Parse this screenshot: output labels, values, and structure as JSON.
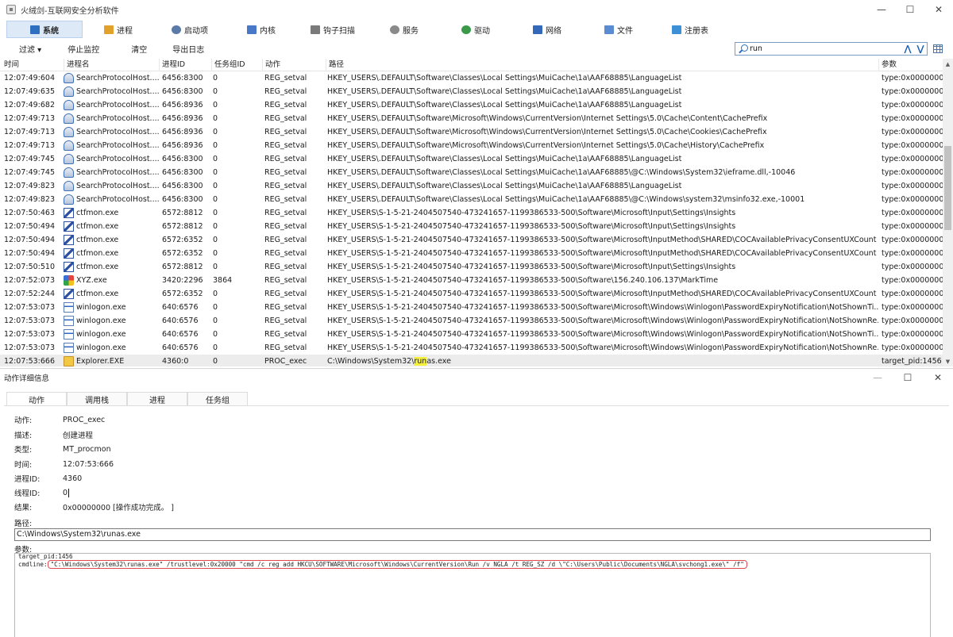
{
  "app": {
    "title": "火绒剑-互联网安全分析软件",
    "window_controls": {
      "minimize": "—",
      "maximize": "☐",
      "close": "✕"
    }
  },
  "main_tabs": [
    {
      "label": "系统",
      "icon": "system-icon",
      "color": "#2f6fbf",
      "active": true
    },
    {
      "label": "进程",
      "icon": "process-icon",
      "color": "#e2a12a",
      "active": false
    },
    {
      "label": "启动项",
      "icon": "startup-icon",
      "color": "#5a7aa8",
      "active": false
    },
    {
      "label": "内核",
      "icon": "kernel-icon",
      "color": "#4a78c8",
      "active": false
    },
    {
      "label": "钩子扫描",
      "icon": "hook-icon",
      "color": "#7a7a7a",
      "active": false
    },
    {
      "label": "服务",
      "icon": "service-icon",
      "color": "#8a8a8a",
      "active": false
    },
    {
      "label": "驱动",
      "icon": "driver-icon",
      "color": "#3a9a4a",
      "active": false
    },
    {
      "label": "网络",
      "icon": "network-icon",
      "color": "#3468b8",
      "active": false
    },
    {
      "label": "文件",
      "icon": "file-icon",
      "color": "#5b8bd0",
      "active": false
    },
    {
      "label": "注册表",
      "icon": "registry-icon",
      "color": "#3d8fd6",
      "active": false
    }
  ],
  "toolbar": {
    "filter_label": "过滤 ▾",
    "stop_label": "停止监控",
    "clear_label": "清空",
    "export_label": "导出日志",
    "search_value": "run",
    "nav_up": "⋀",
    "nav_down": "⋁"
  },
  "table": {
    "columns": [
      "时间",
      "进程名",
      "进程ID",
      "任务组ID",
      "动作",
      "路径",
      "参数"
    ],
    "rows": [
      {
        "time": "12:07:49:604",
        "icon": "search-host-icon",
        "proc": "SearchProtocolHost....",
        "pid": "6456:8300",
        "task": "0",
        "action": "REG_setval",
        "path": "HKEY_USERS\\.DEFAULT\\Software\\Classes\\Local Settings\\MuiCache\\1a\\AAF68885\\LanguageList",
        "param": "type:0x00000007"
      },
      {
        "time": "12:07:49:635",
        "icon": "search-host-icon",
        "proc": "SearchProtocolHost....",
        "pid": "6456:8300",
        "task": "0",
        "action": "REG_setval",
        "path": "HKEY_USERS\\.DEFAULT\\Software\\Classes\\Local Settings\\MuiCache\\1a\\AAF68885\\LanguageList",
        "param": "type:0x00000007"
      },
      {
        "time": "12:07:49:682",
        "icon": "search-host-icon",
        "proc": "SearchProtocolHost....",
        "pid": "6456:8936",
        "task": "0",
        "action": "REG_setval",
        "path": "HKEY_USERS\\.DEFAULT\\Software\\Classes\\Local Settings\\MuiCache\\1a\\AAF68885\\LanguageList",
        "param": "type:0x00000007"
      },
      {
        "time": "12:07:49:713",
        "icon": "search-host-icon",
        "proc": "SearchProtocolHost....",
        "pid": "6456:8936",
        "task": "0",
        "action": "REG_setval",
        "path": "HKEY_USERS\\.DEFAULT\\Software\\Microsoft\\Windows\\CurrentVersion\\Internet Settings\\5.0\\Cache\\Content\\CachePrefix",
        "param": "type:0x00000001"
      },
      {
        "time": "12:07:49:713",
        "icon": "search-host-icon",
        "proc": "SearchProtocolHost....",
        "pid": "6456:8936",
        "task": "0",
        "action": "REG_setval",
        "path": "HKEY_USERS\\.DEFAULT\\Software\\Microsoft\\Windows\\CurrentVersion\\Internet Settings\\5.0\\Cache\\Cookies\\CachePrefix",
        "param": "type:0x00000001"
      },
      {
        "time": "12:07:49:713",
        "icon": "search-host-icon",
        "proc": "SearchProtocolHost....",
        "pid": "6456:8936",
        "task": "0",
        "action": "REG_setval",
        "path": "HKEY_USERS\\.DEFAULT\\Software\\Microsoft\\Windows\\CurrentVersion\\Internet Settings\\5.0\\Cache\\History\\CachePrefix",
        "param": "type:0x00000001"
      },
      {
        "time": "12:07:49:745",
        "icon": "search-host-icon",
        "proc": "SearchProtocolHost....",
        "pid": "6456:8300",
        "task": "0",
        "action": "REG_setval",
        "path": "HKEY_USERS\\.DEFAULT\\Software\\Classes\\Local Settings\\MuiCache\\1a\\AAF68885\\LanguageList",
        "param": "type:0x00000007"
      },
      {
        "time": "12:07:49:745",
        "icon": "search-host-icon",
        "proc": "SearchProtocolHost....",
        "pid": "6456:8300",
        "task": "0",
        "action": "REG_setval",
        "path": "HKEY_USERS\\.DEFAULT\\Software\\Classes\\Local Settings\\MuiCache\\1a\\AAF68885\\@C:\\Windows\\System32\\ieframe.dll,-10046",
        "param": "type:0x00000001"
      },
      {
        "time": "12:07:49:823",
        "icon": "search-host-icon",
        "proc": "SearchProtocolHost....",
        "pid": "6456:8300",
        "task": "0",
        "action": "REG_setval",
        "path": "HKEY_USERS\\.DEFAULT\\Software\\Classes\\Local Settings\\MuiCache\\1a\\AAF68885\\LanguageList",
        "param": "type:0x00000007"
      },
      {
        "time": "12:07:49:823",
        "icon": "search-host-icon",
        "proc": "SearchProtocolHost....",
        "pid": "6456:8300",
        "task": "0",
        "action": "REG_setval",
        "path": "HKEY_USERS\\.DEFAULT\\Software\\Classes\\Local Settings\\MuiCache\\1a\\AAF68885\\@C:\\Windows\\system32\\msinfo32.exe,-10001",
        "param": "type:0x00000001"
      },
      {
        "time": "12:07:50:463",
        "icon": "ctfmon-icon",
        "proc": "ctfmon.exe",
        "pid": "6572:8812",
        "task": "0",
        "action": "REG_setval",
        "path": "HKEY_USERS\\S-1-5-21-2404507540-473241657-1199386533-500\\Software\\Microsoft\\Input\\Settings\\Insights",
        "param": "type:0x00000003"
      },
      {
        "time": "12:07:50:494",
        "icon": "ctfmon-icon",
        "proc": "ctfmon.exe",
        "pid": "6572:8812",
        "task": "0",
        "action": "REG_setval",
        "path": "HKEY_USERS\\S-1-5-21-2404507540-473241657-1199386533-500\\Software\\Microsoft\\Input\\Settings\\Insights",
        "param": "type:0x00000003"
      },
      {
        "time": "12:07:50:494",
        "icon": "ctfmon-icon",
        "proc": "ctfmon.exe",
        "pid": "6572:6352",
        "task": "0",
        "action": "REG_setval",
        "path": "HKEY_USERS\\S-1-5-21-2404507540-473241657-1199386533-500\\Software\\Microsoft\\InputMethod\\SHARED\\COCAvailablePrivacyConsentUXCount",
        "param": "type:0x00000004"
      },
      {
        "time": "12:07:50:494",
        "icon": "ctfmon-icon",
        "proc": "ctfmon.exe",
        "pid": "6572:6352",
        "task": "0",
        "action": "REG_setval",
        "path": "HKEY_USERS\\S-1-5-21-2404507540-473241657-1199386533-500\\Software\\Microsoft\\InputMethod\\SHARED\\COCAvailablePrivacyConsentUXCount",
        "param": "type:0x00000004"
      },
      {
        "time": "12:07:50:510",
        "icon": "ctfmon-icon",
        "proc": "ctfmon.exe",
        "pid": "6572:8812",
        "task": "0",
        "action": "REG_setval",
        "path": "HKEY_USERS\\S-1-5-21-2404507540-473241657-1199386533-500\\Software\\Microsoft\\Input\\Settings\\Insights",
        "param": "type:0x00000003"
      },
      {
        "time": "12:07:52:073",
        "icon": "xyz-icon",
        "proc": "XYZ.exe",
        "pid": "3420:2296",
        "task": "3864",
        "action": "REG_setval",
        "path": "HKEY_USERS\\S-1-5-21-2404507540-473241657-1199386533-500\\Software\\156.240.106.137\\MarkTime",
        "param": "type:0x00000001"
      },
      {
        "time": "12:07:52:244",
        "icon": "ctfmon-icon",
        "proc": "ctfmon.exe",
        "pid": "6572:6352",
        "task": "0",
        "action": "REG_setval",
        "path": "HKEY_USERS\\S-1-5-21-2404507540-473241657-1199386533-500\\Software\\Microsoft\\InputMethod\\SHARED\\COCAvailablePrivacyConsentUXCount",
        "param": "type:0x00000004"
      },
      {
        "time": "12:07:53:073",
        "icon": "winlogon-icon",
        "proc": "winlogon.exe",
        "pid": "640:6576",
        "task": "0",
        "action": "REG_setval",
        "path": "HKEY_USERS\\S-1-5-21-2404507540-473241657-1199386533-500\\Software\\Microsoft\\Windows\\Winlogon\\PasswordExpiryNotification\\NotShownTi...",
        "param": "type:0x00000001"
      },
      {
        "time": "12:07:53:073",
        "icon": "winlogon-icon",
        "proc": "winlogon.exe",
        "pid": "640:6576",
        "task": "0",
        "action": "REG_setval",
        "path": "HKEY_USERS\\S-1-5-21-2404507540-473241657-1199386533-500\\Software\\Microsoft\\Windows\\Winlogon\\PasswordExpiryNotification\\NotShownRe...",
        "param": "type:0x00000001"
      },
      {
        "time": "12:07:53:073",
        "icon": "winlogon-icon",
        "proc": "winlogon.exe",
        "pid": "640:6576",
        "task": "0",
        "action": "REG_setval",
        "path": "HKEY_USERS\\S-1-5-21-2404507540-473241657-1199386533-500\\Software\\Microsoft\\Windows\\Winlogon\\PasswordExpiryNotification\\NotShownTi...",
        "param": "type:0x00000001"
      },
      {
        "time": "12:07:53:073",
        "icon": "winlogon-icon",
        "proc": "winlogon.exe",
        "pid": "640:6576",
        "task": "0",
        "action": "REG_setval",
        "path": "HKEY_USERS\\S-1-5-21-2404507540-473241657-1199386533-500\\Software\\Microsoft\\Windows\\Winlogon\\PasswordExpiryNotification\\NotShownRe...",
        "param": "type:0x00000001"
      },
      {
        "time": "12:07:53:666",
        "icon": "explorer-icon",
        "proc": "Explorer.EXE",
        "pid": "4360:0",
        "task": "0",
        "action": "PROC_exec",
        "path_pre": "C:\\Windows\\System32\\",
        "path_hl": "run",
        "path_post": "as.exe",
        "path": "C:\\Windows\\System32\\runas.exe",
        "param": "target_pid:1456",
        "selected": true
      }
    ]
  },
  "detail": {
    "title": "动作详细信息",
    "controls": {
      "minimize": "—",
      "maximize": "☐",
      "close": "✕"
    },
    "tabs": [
      "动作",
      "调用栈",
      "进程",
      "任务组"
    ],
    "fields": [
      {
        "label": "动作:",
        "value": "PROC_exec"
      },
      {
        "label": "描述:",
        "value": "创建进程"
      },
      {
        "label": "类型:",
        "value": "MT_procmon"
      },
      {
        "label": "时间:",
        "value": "12:07:53:666"
      },
      {
        "label": "进程ID:",
        "value": "4360"
      },
      {
        "label": "线程ID:",
        "value": "0"
      },
      {
        "label": "结果:",
        "value": "0x00000000 [操作成功完成。 ]"
      }
    ],
    "path_label": "路径:",
    "path_value": "C:\\Windows\\System32\\runas.exe",
    "param_label": "参数:",
    "param_line1": "target_pid:1456",
    "cmdline_label": "cmdline:",
    "cmdline_value": "\"C:\\Windows\\System32\\runas.exe\" /trustlevel:0x20000 \"cmd /c reg add HKCU\\SOFTWARE\\Microsoft\\Windows\\CurrentVersion\\Run /v NGLA /t REG_SZ /d \\\"C:\\Users\\Public\\Documents\\NGLA\\svchong1.exe\\\" /f\"",
    "cmdline_highlight_color": "#e0484b"
  },
  "colors": {
    "selected_row": "#ececec",
    "search_highlight": "#f5f13a",
    "active_tab": "#dde9f7"
  }
}
